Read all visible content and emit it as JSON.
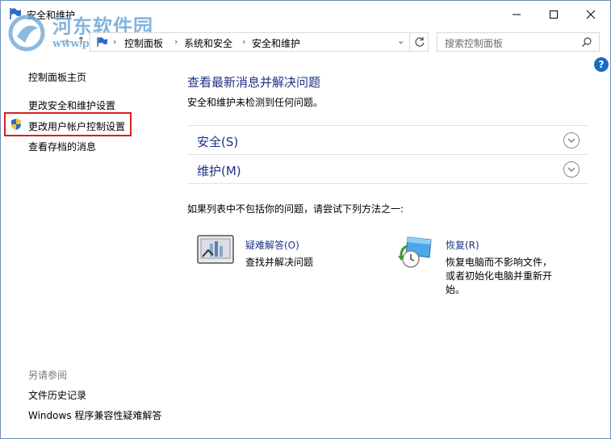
{
  "window": {
    "title": "安全和维护",
    "minimize_icon": "minimize-icon",
    "maximize_icon": "maximize-icon",
    "close_icon": "close-icon"
  },
  "watermark": {
    "name": "河东软件园",
    "url": "www.pc0359.cn"
  },
  "address_bar": {
    "crumbs": [
      "控制面板",
      "系统和安全",
      "安全和维护"
    ],
    "search_placeholder": "搜索控制面板"
  },
  "sidebar": {
    "home": "控制面板主页",
    "items": [
      "更改安全和维护设置",
      "更改用户帐户控制设置",
      "查看存档的消息"
    ],
    "see_also_title": "另请参阅",
    "see_also": [
      "文件历史记录",
      "Windows 程序兼容性疑难解答"
    ]
  },
  "main": {
    "title": "查看最新消息并解决问题",
    "status": "安全和维护未检测到任何问题。",
    "sections": [
      "安全(S)",
      "维护(M)"
    ],
    "hint": "如果列表中不包括你的问题，请尝试下列方法之一:",
    "options": [
      {
        "title": "疑难解答(O)",
        "desc": [
          "查找并解决问题"
        ],
        "icon": "troubleshoot-icon"
      },
      {
        "title": "恢复(R)",
        "desc": [
          "恢复电脑而不影响文件，",
          "或者初始化电脑并重新开",
          "始。"
        ],
        "icon": "recovery-icon"
      }
    ]
  },
  "colors": {
    "link": "#1e3287",
    "highlight": "#d32222"
  }
}
